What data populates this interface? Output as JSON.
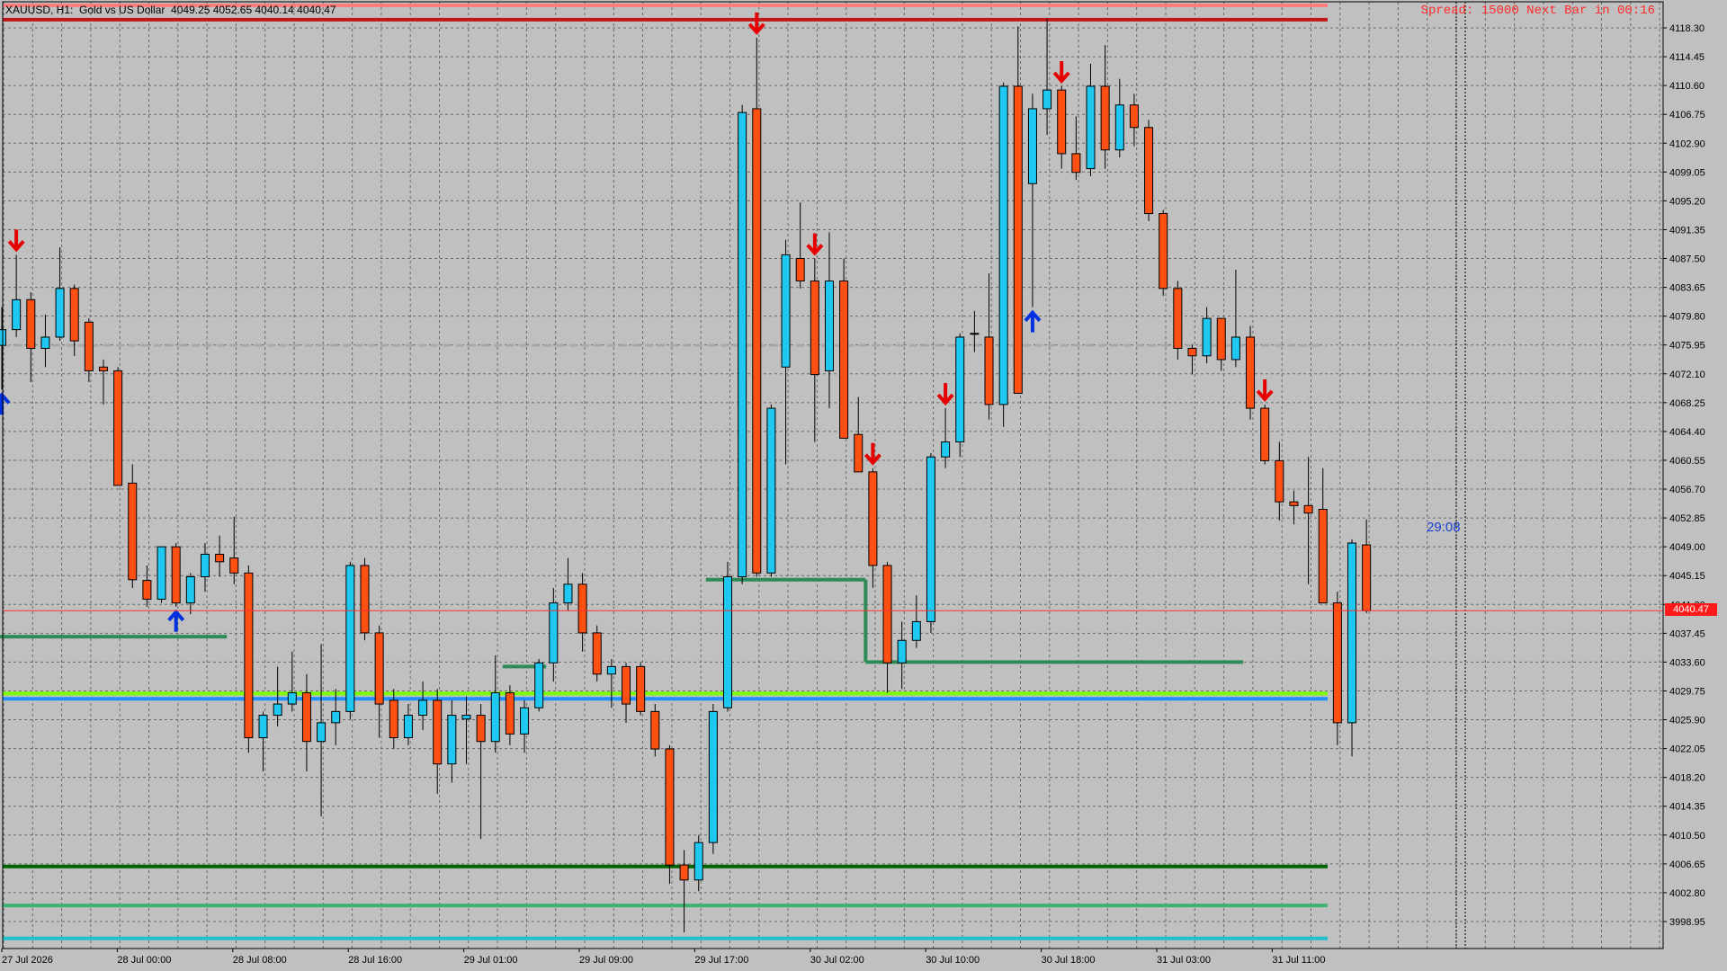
{
  "header": {
    "symbol_line": "XAUUSD, H1:  Gold vs US Dollar  4049.25 4052.65 4040.14 4040.47"
  },
  "status": {
    "spread_text": "Spread: 15000 Next Bar in 00:16",
    "bar_countdown_text": "29:08"
  },
  "current_price": {
    "value": 4040.47,
    "label": "4040.47"
  },
  "colors": {
    "background": "#c0c0c0",
    "bull": "#1ec8f0",
    "bear": "#ff5014",
    "wick": "#000000",
    "grid": "#6a6a6a",
    "sell_arrow": "#e60000",
    "buy_arrow": "#0030e0",
    "step_line": "#2e8b57",
    "price_line": "#ff3030",
    "resistance_top": "#ff7f7f",
    "resistance_2": "#c01818",
    "support_dark": "#006400",
    "support_green": "#3cb371",
    "support_light": "#7cfc00",
    "support_blue": "#1e90ff",
    "support_cyan": "#20c0d0"
  },
  "price_axis": {
    "labels": [
      "4118.30",
      "4114.45",
      "4110.60",
      "4106.75",
      "4102.90",
      "4099.05",
      "4095.20",
      "4091.35",
      "4087.50",
      "4083.65",
      "4079.80",
      "4075.95",
      "4072.10",
      "4068.25",
      "4064.40",
      "4060.55",
      "4056.70",
      "4052.85",
      "4049.00",
      "4045.15",
      "4041.30",
      "4037.45",
      "4033.60",
      "4029.75",
      "4025.90",
      "4022.05",
      "4018.20",
      "4014.35",
      "4010.50",
      "4006.65",
      "4002.80",
      "3998.95"
    ]
  },
  "time_axis": {
    "labels": [
      "27 Jul 2026",
      "28 Jul 00:00",
      "28 Jul 08:00",
      "28 Jul 16:00",
      "29 Jul 01:00",
      "29 Jul 09:00",
      "29 Jul 17:00",
      "30 Jul 02:00",
      "30 Jul 10:00",
      "30 Jul 18:00",
      "31 Jul 03:00",
      "31 Jul 11:00"
    ]
  },
  "chart_data": {
    "type": "candlestick",
    "symbol": "XAUUSD",
    "timeframe": "H1",
    "ylim": [
      3996.5,
      4123.0
    ],
    "candles": [
      {
        "o": 4075.9,
        "h": 4081.0,
        "l": 4070.0,
        "c": 4078.0
      },
      {
        "o": 4078.0,
        "h": 4088.0,
        "l": 4077.0,
        "c": 4082.0
      },
      {
        "o": 4082.0,
        "h": 4083.0,
        "l": 4071.0,
        "c": 4075.5
      },
      {
        "o": 4075.5,
        "h": 4080.0,
        "l": 4073.0,
        "c": 4077.0
      },
      {
        "o": 4077.0,
        "h": 4089.0,
        "l": 4076.5,
        "c": 4083.5
      },
      {
        "o": 4083.5,
        "h": 4084.0,
        "l": 4074.5,
        "c": 4076.5
      },
      {
        "o": 4079.0,
        "h": 4079.5,
        "l": 4071.0,
        "c": 4072.5
      },
      {
        "o": 4073.0,
        "h": 4074.0,
        "l": 4068.0,
        "c": 4072.5
      },
      {
        "o": 4072.5,
        "h": 4073.0,
        "l": 4057.5,
        "c": 4057.2
      },
      {
        "o": 4057.5,
        "h": 4060.0,
        "l": 4043.5,
        "c": 4044.6
      },
      {
        "o": 4044.5,
        "h": 4046.5,
        "l": 4041.0,
        "c": 4042.0
      },
      {
        "o": 4042.0,
        "h": 4049.0,
        "l": 4041.5,
        "c": 4049.0
      },
      {
        "o": 4049.0,
        "h": 4049.5,
        "l": 4041.0,
        "c": 4041.5
      },
      {
        "o": 4041.5,
        "h": 4045.5,
        "l": 4040.0,
        "c": 4045.0
      },
      {
        "o": 4045.0,
        "h": 4049.5,
        "l": 4043.0,
        "c": 4048.0
      },
      {
        "o": 4048.0,
        "h": 4050.5,
        "l": 4045.0,
        "c": 4047.0
      },
      {
        "o": 4047.5,
        "h": 4053.0,
        "l": 4044.0,
        "c": 4045.5
      },
      {
        "o": 4045.5,
        "h": 4046.5,
        "l": 4021.5,
        "c": 4023.5
      },
      {
        "o": 4023.5,
        "h": 4027.0,
        "l": 4019.0,
        "c": 4026.5
      },
      {
        "o": 4026.5,
        "h": 4033.0,
        "l": 4025.0,
        "c": 4028.0
      },
      {
        "o": 4028.0,
        "h": 4035.0,
        "l": 4027.0,
        "c": 4029.5
      },
      {
        "o": 4029.5,
        "h": 4032.0,
        "l": 4019.0,
        "c": 4023.0
      },
      {
        "o": 4023.0,
        "h": 4036.0,
        "l": 4013.0,
        "c": 4025.5
      },
      {
        "o": 4025.5,
        "h": 4030.0,
        "l": 4022.5,
        "c": 4027.0
      },
      {
        "o": 4027.0,
        "h": 4047.0,
        "l": 4026.0,
        "c": 4046.5
      },
      {
        "o": 4046.5,
        "h": 4047.5,
        "l": 4036.5,
        "c": 4037.5
      },
      {
        "o": 4037.5,
        "h": 4038.5,
        "l": 4023.5,
        "c": 4028.0
      },
      {
        "o": 4028.5,
        "h": 4030.0,
        "l": 4022.0,
        "c": 4023.5
      },
      {
        "o": 4023.5,
        "h": 4028.0,
        "l": 4022.5,
        "c": 4026.5
      },
      {
        "o": 4026.5,
        "h": 4031.0,
        "l": 4024.5,
        "c": 4028.5
      },
      {
        "o": 4028.5,
        "h": 4030.0,
        "l": 4016.0,
        "c": 4020.0
      },
      {
        "o": 4020.0,
        "h": 4028.5,
        "l": 4017.5,
        "c": 4026.5
      },
      {
        "o": 4026.0,
        "h": 4029.0,
        "l": 4020.0,
        "c": 4026.5
      },
      {
        "o": 4026.5,
        "h": 4028.0,
        "l": 4010.0,
        "c": 4023.0
      },
      {
        "o": 4023.0,
        "h": 4034.5,
        "l": 4021.5,
        "c": 4029.5
      },
      {
        "o": 4029.5,
        "h": 4030.5,
        "l": 4022.5,
        "c": 4024.0
      },
      {
        "o": 4024.0,
        "h": 4028.5,
        "l": 4021.5,
        "c": 4027.5
      },
      {
        "o": 4027.5,
        "h": 4034.0,
        "l": 4027.0,
        "c": 4033.5
      },
      {
        "o": 4033.5,
        "h": 4043.5,
        "l": 4031.0,
        "c": 4041.5
      },
      {
        "o": 4041.5,
        "h": 4047.5,
        "l": 4040.5,
        "c": 4044.0
      },
      {
        "o": 4044.0,
        "h": 4045.5,
        "l": 4035.0,
        "c": 4037.5
      },
      {
        "o": 4037.5,
        "h": 4038.5,
        "l": 4031.0,
        "c": 4032.0
      },
      {
        "o": 4032.0,
        "h": 4034.0,
        "l": 4027.5,
        "c": 4033.0
      },
      {
        "o": 4033.0,
        "h": 4033.5,
        "l": 4025.5,
        "c": 4028.0
      },
      {
        "o": 4033.0,
        "h": 4033.5,
        "l": 4026.5,
        "c": 4027.0
      },
      {
        "o": 4027.0,
        "h": 4028.0,
        "l": 4021.0,
        "c": 4022.0
      },
      {
        "o": 4022.0,
        "h": 4022.5,
        "l": 4004.0,
        "c": 4006.5
      },
      {
        "o": 4006.5,
        "h": 4008.5,
        "l": 3997.5,
        "c": 4004.5
      },
      {
        "o": 4004.5,
        "h": 4010.5,
        "l": 4003.0,
        "c": 4009.5
      },
      {
        "o": 4009.5,
        "h": 4028.0,
        "l": 4008.0,
        "c": 4027.0
      },
      {
        "o": 4027.5,
        "h": 4047.0,
        "l": 4027.0,
        "c": 4045.0
      },
      {
        "o": 4045.0,
        "h": 4108.0,
        "l": 4044.0,
        "c": 4107.0
      },
      {
        "o": 4107.5,
        "h": 4117.0,
        "l": 4045.0,
        "c": 4045.5
      },
      {
        "o": 4045.5,
        "h": 4068.0,
        "l": 4045.0,
        "c": 4067.5
      },
      {
        "o": 4073.0,
        "h": 4090.0,
        "l": 4060.0,
        "c": 4088.0
      },
      {
        "o": 4087.5,
        "h": 4095.0,
        "l": 4083.5,
        "c": 4084.5
      },
      {
        "o": 4084.5,
        "h": 4087.5,
        "l": 4063.0,
        "c": 4072.0
      },
      {
        "o": 4072.5,
        "h": 4091.0,
        "l": 4067.5,
        "c": 4084.5
      },
      {
        "o": 4084.5,
        "h": 4087.5,
        "l": 4064.0,
        "c": 4063.5
      },
      {
        "o": 4064.0,
        "h": 4069.0,
        "l": 4059.0,
        "c": 4059.0
      },
      {
        "o": 4059.0,
        "h": 4059.5,
        "l": 4043.5,
        "c": 4046.5
      },
      {
        "o": 4046.5,
        "h": 4047.0,
        "l": 4029.5,
        "c": 4033.5
      },
      {
        "o": 4033.5,
        "h": 4039.0,
        "l": 4030.0,
        "c": 4036.5
      },
      {
        "o": 4036.5,
        "h": 4042.5,
        "l": 4035.5,
        "c": 4039.0
      },
      {
        "o": 4039.0,
        "h": 4061.5,
        "l": 4037.5,
        "c": 4061.0
      },
      {
        "o": 4061.0,
        "h": 4067.5,
        "l": 4059.5,
        "c": 4063.0
      },
      {
        "o": 4063.0,
        "h": 4077.5,
        "l": 4061.0,
        "c": 4077.0
      },
      {
        "o": 4077.5,
        "h": 4080.5,
        "l": 4075.0,
        "c": 4077.5
      },
      {
        "o": 4077.0,
        "h": 4085.5,
        "l": 4066.0,
        "c": 4068.0
      },
      {
        "o": 4068.0,
        "h": 4111.0,
        "l": 4065.0,
        "c": 4110.5
      },
      {
        "o": 4110.5,
        "h": 4118.5,
        "l": 4088.0,
        "c": 4069.5
      },
      {
        "o": 4097.5,
        "h": 4109.5,
        "l": 4081.0,
        "c": 4107.5
      },
      {
        "o": 4107.5,
        "h": 4119.5,
        "l": 4104.0,
        "c": 4110.0
      },
      {
        "o": 4110.0,
        "h": 4110.5,
        "l": 4099.5,
        "c": 4101.5
      },
      {
        "o": 4101.5,
        "h": 4106.5,
        "l": 4098.0,
        "c": 4099.0
      },
      {
        "o": 4099.5,
        "h": 4113.5,
        "l": 4098.5,
        "c": 4110.5
      },
      {
        "o": 4110.5,
        "h": 4116.0,
        "l": 4099.5,
        "c": 4102.0
      },
      {
        "o": 4102.0,
        "h": 4111.5,
        "l": 4101.0,
        "c": 4108.0
      },
      {
        "o": 4108.0,
        "h": 4109.5,
        "l": 4102.5,
        "c": 4105.0
      },
      {
        "o": 4105.0,
        "h": 4106.0,
        "l": 4092.5,
        "c": 4093.5
      },
      {
        "o": 4093.5,
        "h": 4094.0,
        "l": 4082.5,
        "c": 4083.5
      },
      {
        "o": 4083.5,
        "h": 4084.5,
        "l": 4074.0,
        "c": 4075.5
      },
      {
        "o": 4075.5,
        "h": 4076.0,
        "l": 4072.0,
        "c": 4074.5
      },
      {
        "o": 4074.5,
        "h": 4081.0,
        "l": 4073.5,
        "c": 4079.5
      },
      {
        "o": 4079.5,
        "h": 4079.5,
        "l": 4072.5,
        "c": 4074.0
      },
      {
        "o": 4074.0,
        "h": 4086.0,
        "l": 4073.0,
        "c": 4077.0
      },
      {
        "o": 4077.0,
        "h": 4078.5,
        "l": 4066.0,
        "c": 4067.5
      },
      {
        "o": 4067.5,
        "h": 4068.0,
        "l": 4060.0,
        "c": 4060.5
      },
      {
        "o": 4060.5,
        "h": 4063.0,
        "l": 4052.5,
        "c": 4055.0
      },
      {
        "o": 4055.0,
        "h": 4056.5,
        "l": 4052.0,
        "c": 4054.5
      },
      {
        "o": 4054.5,
        "h": 4061.0,
        "l": 4044.0,
        "c": 4053.5
      },
      {
        "o": 4054.0,
        "h": 4059.5,
        "l": 4041.5,
        "c": 4041.5
      },
      {
        "o": 4041.5,
        "h": 4043.0,
        "l": 4022.5,
        "c": 4025.5
      },
      {
        "o": 4025.5,
        "h": 4050.0,
        "l": 4021.0,
        "c": 4049.5
      },
      {
        "o": 4049.25,
        "h": 4052.65,
        "l": 4040.14,
        "c": 4040.47
      }
    ],
    "horizontal_levels": [
      {
        "price": 4121.3,
        "color": "#ff7f7f"
      },
      {
        "price": 4119.4,
        "color": "#c01818"
      },
      {
        "price": 4029.4,
        "color": "#7cfc00"
      },
      {
        "price": 4028.7,
        "color": "#1e90ff"
      },
      {
        "price": 4006.3,
        "color": "#006400"
      },
      {
        "price": 4001.1,
        "color": "#3cb371"
      },
      {
        "price": 3996.7,
        "color": "#20c0d0"
      }
    ],
    "dashed_level": {
      "price": 4075.9
    },
    "sell_arrows": [
      1,
      52,
      56,
      60,
      65,
      73,
      87
    ],
    "buy_arrows": [
      0,
      12,
      71
    ],
    "step_line": [
      {
        "from": 0,
        "to": 15,
        "price": 4037.0
      },
      {
        "from": 35,
        "to": 37,
        "price": 4033.0
      },
      {
        "from": 49,
        "to": 59,
        "price": 4044.6
      },
      {
        "from": 60,
        "to": 85,
        "price": 4033.6
      }
    ]
  }
}
